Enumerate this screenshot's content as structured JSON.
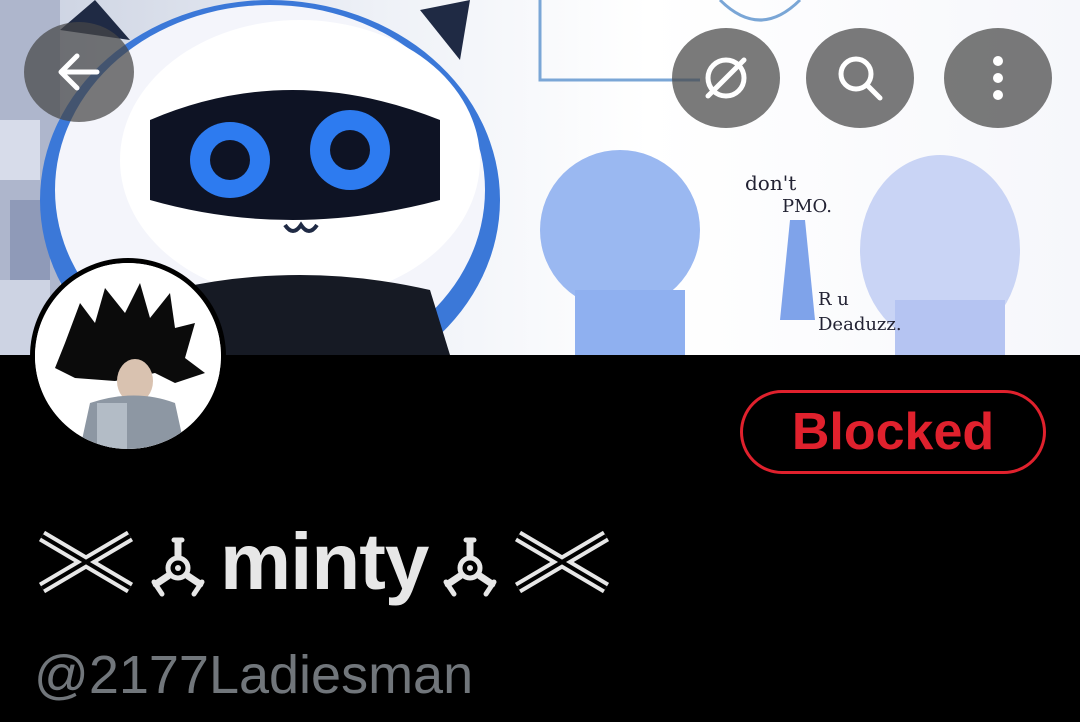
{
  "header": {
    "back_icon": "arrow-left-icon",
    "sensitive_icon": "eye-off-icon",
    "search_icon": "search-icon",
    "more_icon": "more-vertical-icon"
  },
  "banner": {
    "annotations": [
      "don't",
      "PMO.",
      "R u",
      "Deaduzz."
    ]
  },
  "profile": {
    "display_name": "minty",
    "handle": "@2177Ladiesman",
    "relationship_button": "Blocked"
  },
  "colors": {
    "background": "#000000",
    "blocked_red": "#e0212d",
    "handle_gray": "#71767b",
    "name_white": "#e7e7e7"
  }
}
